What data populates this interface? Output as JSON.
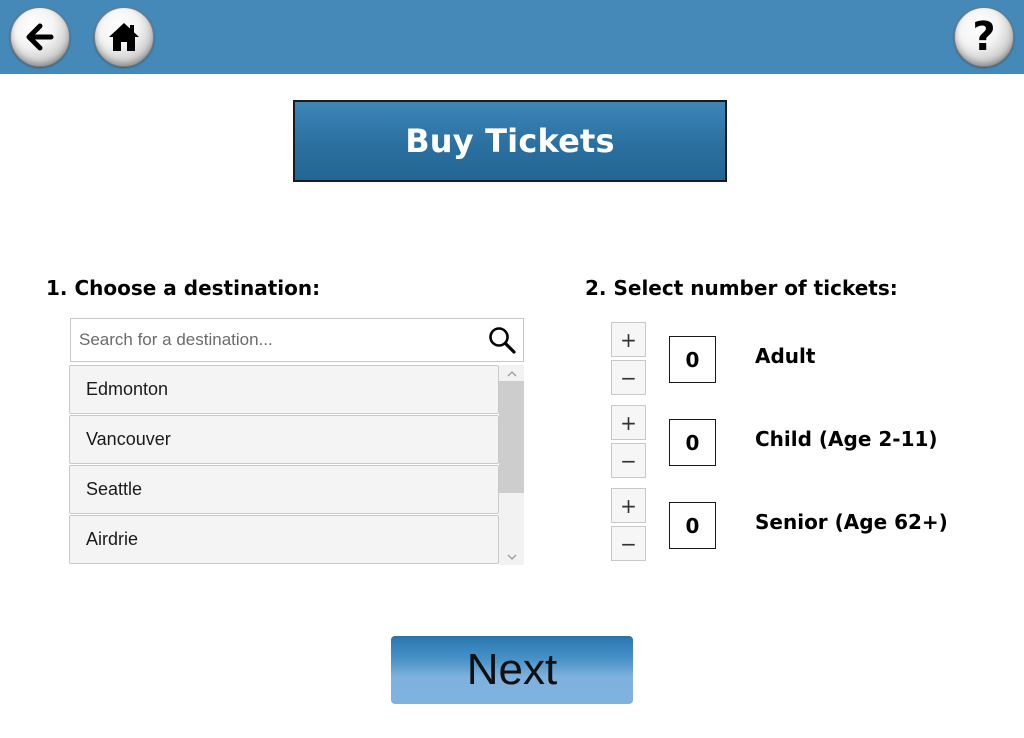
{
  "topbar": {
    "background": "#4589b8",
    "back_icon": "arrow-left-icon",
    "home_icon": "home-icon",
    "help_glyph": "?"
  },
  "title": "Buy Tickets",
  "destination": {
    "heading": "1. Choose a destination:",
    "search": {
      "placeholder": "Search for a destination...",
      "value": "",
      "icon": "search-icon"
    },
    "items": [
      {
        "label": "Edmonton"
      },
      {
        "label": "Vancouver"
      },
      {
        "label": "Seattle"
      },
      {
        "label": "Airdrie"
      }
    ]
  },
  "tickets": {
    "heading": "2. Select number of tickets:",
    "plus_label": "+",
    "minus_label": "−",
    "rows": [
      {
        "label": "Adult",
        "count": "0"
      },
      {
        "label": "Child (Age 2-11)",
        "count": "0"
      },
      {
        "label": "Senior (Age 62+)",
        "count": "0"
      }
    ]
  },
  "next_label": "Next",
  "colors": {
    "accent": "#2a70a0",
    "next_top": "#2676ad",
    "next_bottom": "#80b2df"
  }
}
